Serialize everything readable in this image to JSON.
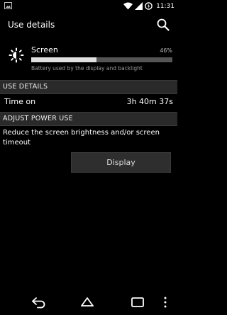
{
  "status_bar": {
    "time": "11:31"
  },
  "action_bar": {
    "title": "Use details"
  },
  "app": {
    "name": "Screen",
    "percent_text": "46%",
    "usage_fraction": 0.46,
    "description": "Battery used by the display and backlight"
  },
  "use_details": {
    "header": "USE DETAILS",
    "rows": [
      {
        "label": "Time on",
        "value": "3h 40m 37s"
      }
    ]
  },
  "power": {
    "header": "ADJUST POWER USE",
    "text": "Reduce the screen brightness and/or screen timeout",
    "button_label": "Display"
  },
  "colors": {
    "background": "#000000",
    "bar_fill": "#e0e0e0",
    "bar_track": "#555555",
    "section_header": "#2a2a2a"
  },
  "icons": {
    "notification": "image-notification-icon",
    "wifi": "wifi-icon",
    "signal": "cell-signal-icon",
    "battery": "battery-charging-icon",
    "search": "search-icon",
    "app": "brightness-icon",
    "nav": [
      "back-icon",
      "home-icon",
      "recents-icon",
      "overflow-menu-icon"
    ]
  }
}
